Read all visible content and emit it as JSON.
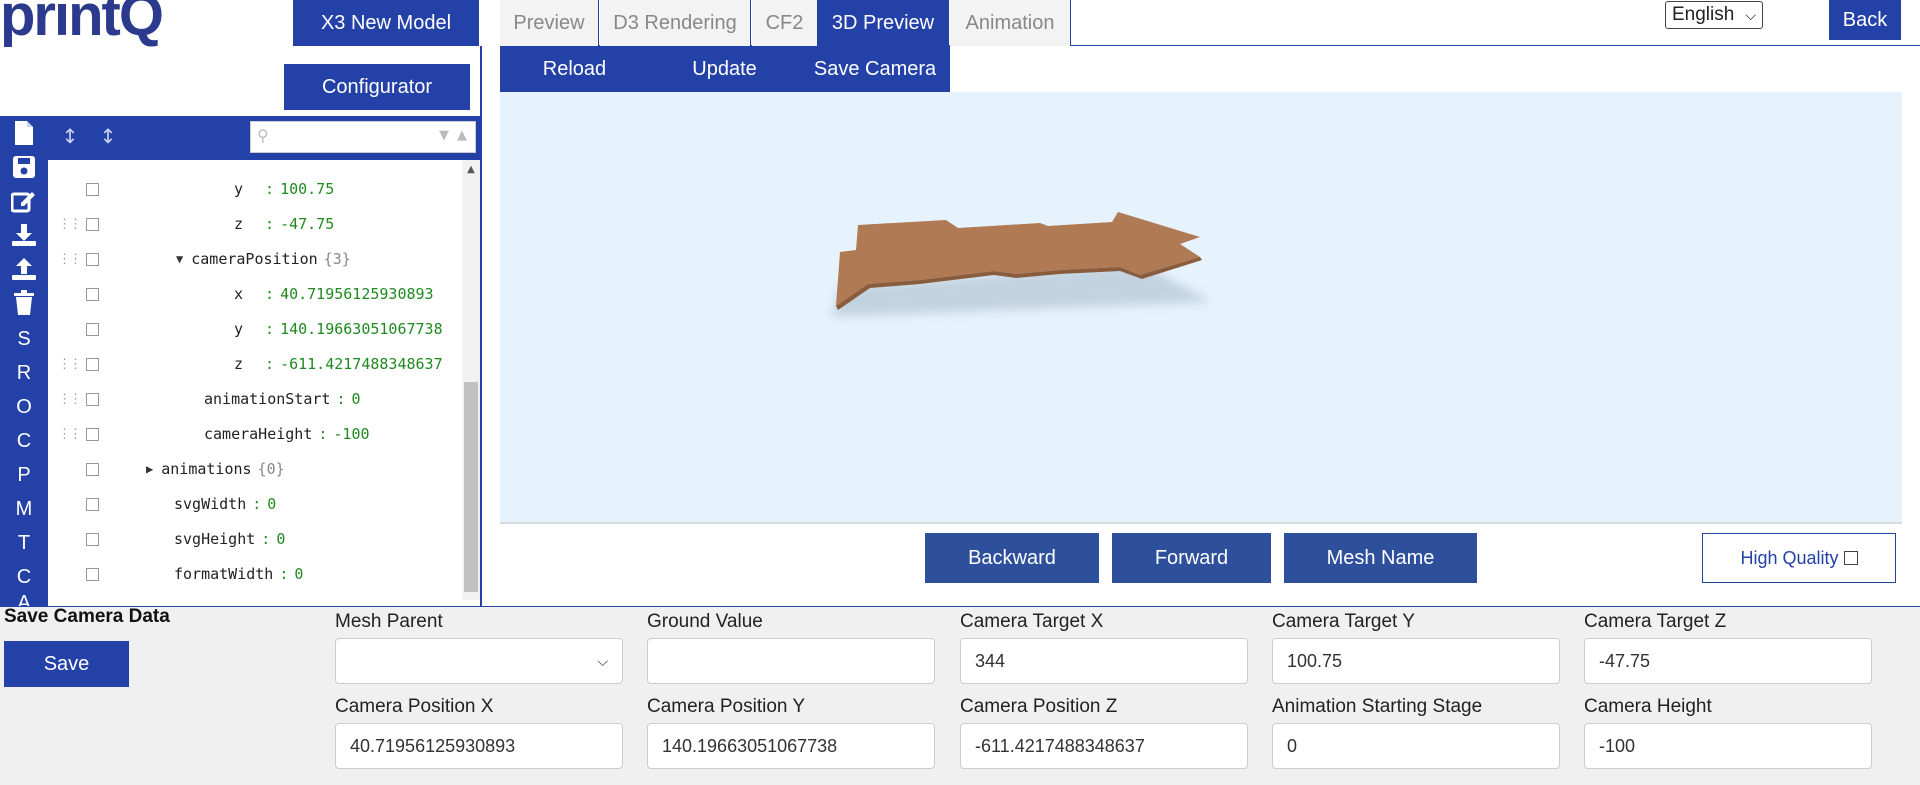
{
  "brand": {
    "logo_text": "printQ"
  },
  "top_buttons": {
    "new_model": "X3 New Model",
    "configurator": "Configurator",
    "back": "Back"
  },
  "language": {
    "selected": "English"
  },
  "tabs": [
    "Preview",
    "D3 Rendering",
    "CF2",
    "3D Preview",
    "Animation"
  ],
  "active_tab": "3D Preview",
  "subtabs": [
    "Reload",
    "Update",
    "Save Camera"
  ],
  "sidebar": {
    "icons": [
      "new-file-icon",
      "save-icon",
      "edit-icon",
      "download-icon",
      "upload-icon",
      "trash-icon"
    ],
    "letters": [
      "S",
      "R",
      "O",
      "C",
      "P",
      "M",
      "T",
      "C",
      "A"
    ]
  },
  "tree": {
    "rows": [
      {
        "key": "y",
        "value": "100.75"
      },
      {
        "key": "z",
        "value": "-47.75"
      },
      {
        "key": "cameraPosition",
        "count": "{3}"
      },
      {
        "key": "x",
        "value": "40.71956125930893"
      },
      {
        "key": "y",
        "value": "140.19663051067738"
      },
      {
        "key": "z",
        "value": "-611.4217488348637"
      },
      {
        "key": "animationStart",
        "value": "0"
      },
      {
        "key": "cameraHeight",
        "value": "-100"
      },
      {
        "key": "animations",
        "count": "{0}"
      },
      {
        "key": "svgWidth",
        "value": "0"
      },
      {
        "key": "svgHeight",
        "value": "0"
      },
      {
        "key": "formatWidth",
        "value": "0"
      }
    ]
  },
  "controls": {
    "backward": "Backward",
    "forward": "Forward",
    "mesh_name": "Mesh Name",
    "high_quality": "High Quality"
  },
  "form": {
    "heading": "Save Camera Data",
    "save": "Save",
    "fields": [
      {
        "label": "Mesh Parent",
        "value": ""
      },
      {
        "label": "Ground Value",
        "value": ""
      },
      {
        "label": "Camera Target X",
        "value": "344"
      },
      {
        "label": "Camera Target Y",
        "value": "100.75"
      },
      {
        "label": "Camera Target Z",
        "value": "-47.75"
      },
      {
        "label": "Camera Position X",
        "value": "40.71956125930893"
      },
      {
        "label": "Camera Position Y",
        "value": "140.19663051067738"
      },
      {
        "label": "Camera Position Z",
        "value": "-611.4217488348637"
      },
      {
        "label": "Animation Starting Stage",
        "value": "0"
      },
      {
        "label": "Camera Height",
        "value": "-100"
      }
    ]
  },
  "colors": {
    "primary": "#2441a8",
    "viewport": "#e6f3fd",
    "model": "#b07a55",
    "tree_value": "#1f8a1f"
  }
}
